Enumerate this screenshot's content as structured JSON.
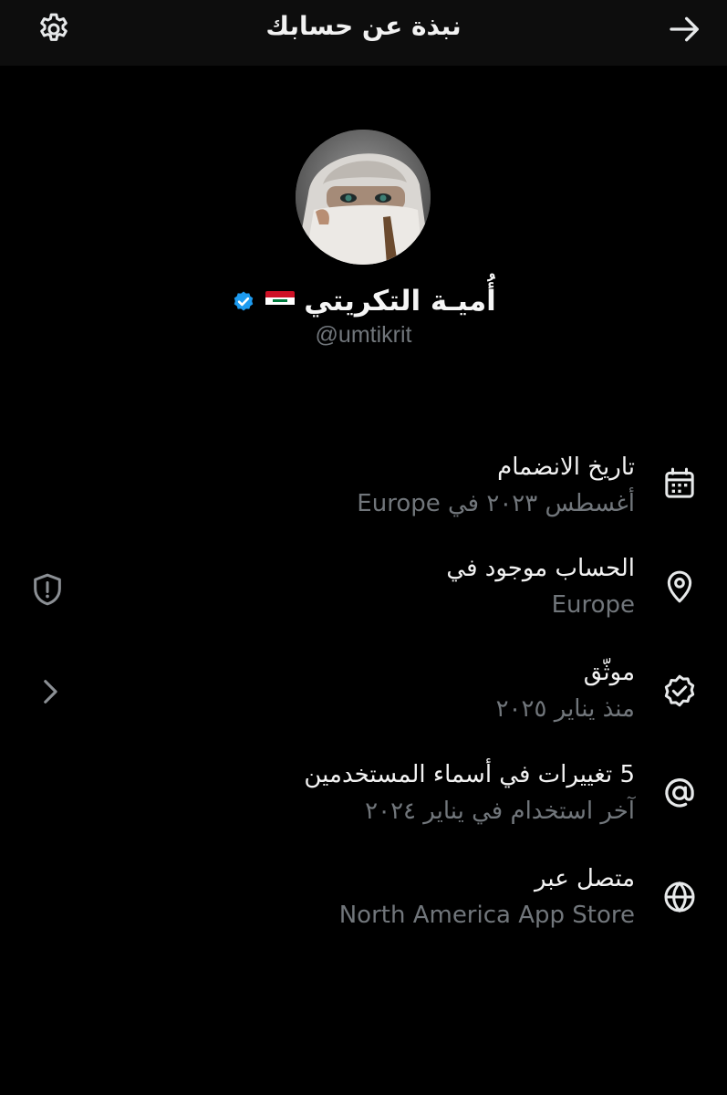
{
  "header": {
    "title": "نبذة عن حسابك",
    "settings_icon": "gear-icon",
    "back_icon": "arrow-right-icon"
  },
  "profile": {
    "display_name": "أُميـة التكريتي",
    "flag": "iraq-flag",
    "verified": true,
    "handle": "@umtikrit"
  },
  "info": {
    "join": {
      "icon": "calendar-icon",
      "label": "تاريخ الانضمام",
      "value": "أغسطس ٢٠٢٣ في Europe"
    },
    "location": {
      "icon": "location-pin-icon",
      "label": "الحساب موجود في",
      "value": "Europe"
    },
    "verified": {
      "icon": "verified-check-icon",
      "label": "موثّق",
      "value": "منذ يناير ٢٠٢٥"
    },
    "usernames": {
      "icon": "at-sign-icon",
      "label": "5 تغييرات في أسماء المستخدمين",
      "value": "آخر استخدام في يناير ٢٠٢٤"
    },
    "connected": {
      "icon": "globe-icon",
      "label": "متصل عبر",
      "value": "North America App Store"
    }
  },
  "side": {
    "shield_icon": "shield-alert-icon",
    "chevron_icon": "chevron-right-icon"
  },
  "colors": {
    "background": "#000000",
    "header_background": "#0d0d0d",
    "primary_text": "#e7e9ea",
    "secondary_text": "#71767b",
    "verified_blue": "#1d9bf0"
  }
}
